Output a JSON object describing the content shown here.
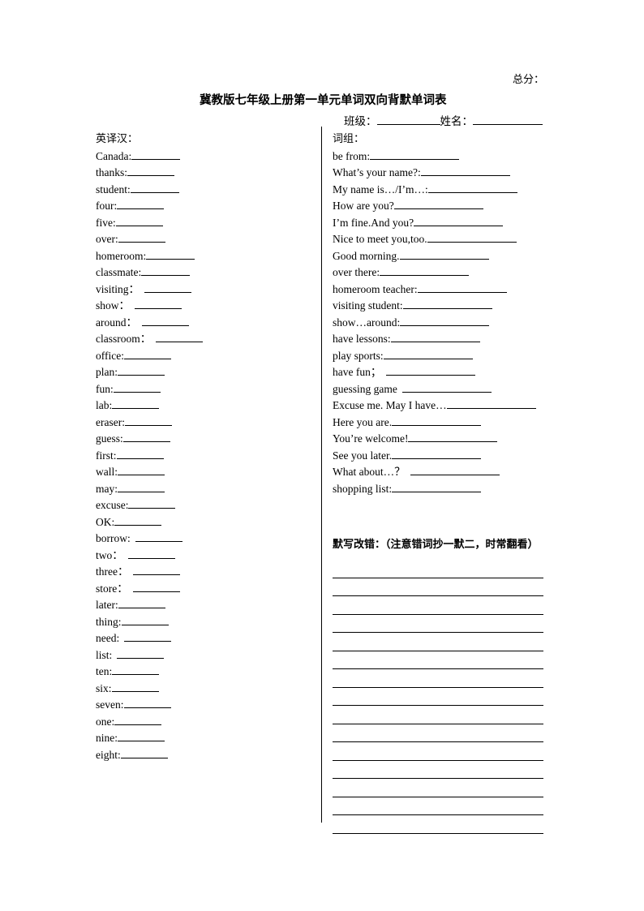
{
  "header": {
    "total_score_label": "总分：",
    "title": "冀教版七年级上册第一单元单词双向背默单词表",
    "class_label": "班级：",
    "name_label": "姓名："
  },
  "left_column": {
    "heading": "英译汉：",
    "entries": [
      {
        "label": "Canada:",
        "blank_width": 60,
        "spaced": false
      },
      {
        "label": "thanks:",
        "blank_width": 58,
        "spaced": false
      },
      {
        "label": "student:",
        "blank_width": 60,
        "spaced": false
      },
      {
        "label": "four:",
        "blank_width": 58,
        "spaced": false
      },
      {
        "label": "five:",
        "blank_width": 58,
        "spaced": false
      },
      {
        "label": "over:",
        "blank_width": 58,
        "spaced": false
      },
      {
        "label": "homeroom:",
        "blank_width": 60,
        "spaced": false
      },
      {
        "label": "classmate:",
        "blank_width": 60,
        "spaced": false
      },
      {
        "label": "visiting：",
        "blank_width": 58,
        "spaced": true
      },
      {
        "label": "show：",
        "blank_width": 58,
        "spaced": true
      },
      {
        "label": "around：",
        "blank_width": 58,
        "spaced": true
      },
      {
        "label": "classroom：",
        "blank_width": 58,
        "spaced": true
      },
      {
        "label": "office:",
        "blank_width": 58,
        "spaced": false
      },
      {
        "label": "plan:",
        "blank_width": 58,
        "spaced": false
      },
      {
        "label": "fun:",
        "blank_width": 58,
        "spaced": false
      },
      {
        "label": "lab:",
        "blank_width": 58,
        "spaced": false
      },
      {
        "label": "eraser:",
        "blank_width": 58,
        "spaced": false
      },
      {
        "label": "guess:",
        "blank_width": 58,
        "spaced": false
      },
      {
        "label": "first:",
        "blank_width": 58,
        "spaced": false
      },
      {
        "label": "wall:",
        "blank_width": 58,
        "spaced": false
      },
      {
        "label": "may:",
        "blank_width": 58,
        "spaced": false
      },
      {
        "label": "excuse:",
        "blank_width": 58,
        "spaced": false
      },
      {
        "label": "OK:",
        "blank_width": 58,
        "spaced": false
      },
      {
        "label": "borrow:",
        "blank_width": 58,
        "spaced": true
      },
      {
        "label": "two：",
        "blank_width": 58,
        "spaced": true
      },
      {
        "label": "three：",
        "blank_width": 58,
        "spaced": true
      },
      {
        "label": "store：",
        "blank_width": 58,
        "spaced": true
      },
      {
        "label": "later:",
        "blank_width": 58,
        "spaced": false
      },
      {
        "label": "thing:",
        "blank_width": 58,
        "spaced": false
      },
      {
        "label": "need:",
        "blank_width": 58,
        "spaced": true
      },
      {
        "label": "list:",
        "blank_width": 58,
        "spaced": true
      },
      {
        "label": "ten:",
        "blank_width": 58,
        "spaced": false
      },
      {
        "label": "six:",
        "blank_width": 58,
        "spaced": false
      },
      {
        "label": "seven:",
        "blank_width": 58,
        "spaced": false
      },
      {
        "label": "one:",
        "blank_width": 58,
        "spaced": false
      },
      {
        "label": "nine:",
        "blank_width": 58,
        "spaced": false
      },
      {
        "label": "eight:",
        "blank_width": 58,
        "spaced": false
      }
    ]
  },
  "right_column": {
    "heading": "词组：",
    "entries": [
      {
        "label": "be from:",
        "blank_width": 110,
        "spaced": false
      },
      {
        "label": "What’s your name?:",
        "blank_width": 110,
        "spaced": false
      },
      {
        "label": "My name is…/I’m…:",
        "blank_width": 110,
        "spaced": false
      },
      {
        "label": "How are you?",
        "blank_width": 110,
        "spaced": false
      },
      {
        "label": "I’m fine.And you?",
        "blank_width": 110,
        "spaced": false
      },
      {
        "label": "Nice to meet you,too.",
        "blank_width": 110,
        "spaced": false
      },
      {
        "label": "Good morning.",
        "blank_width": 110,
        "spaced": false
      },
      {
        "label": "over there:",
        "blank_width": 110,
        "spaced": false
      },
      {
        "label": "homeroom teacher:",
        "blank_width": 110,
        "spaced": false
      },
      {
        "label": "visiting student:",
        "blank_width": 110,
        "spaced": false
      },
      {
        "label": "show…around:",
        "blank_width": 110,
        "spaced": false
      },
      {
        "label": "have lessons:",
        "blank_width": 110,
        "spaced": false
      },
      {
        "label": "play sports:",
        "blank_width": 110,
        "spaced": false
      },
      {
        "label": "have fun；",
        "blank_width": 110,
        "spaced": true
      },
      {
        "label": "guessing game",
        "blank_width": 110,
        "spaced": true
      },
      {
        "label": "Excuse me. May I have…",
        "blank_width": 110,
        "spaced": false
      },
      {
        "label": "Here you are.",
        "blank_width": 110,
        "spaced": false
      },
      {
        "label": "You’re welcome!",
        "blank_width": 110,
        "spaced": false
      },
      {
        "label": "See you later.",
        "blank_width": 110,
        "spaced": false
      },
      {
        "label": "What about…？",
        "blank_width": 110,
        "spaced": true
      },
      {
        "label": "shopping list:",
        "blank_width": 110,
        "spaced": false
      }
    ]
  },
  "correction": {
    "heading": "默写改错：（注意错词抄一默二，时常翻看）",
    "line_count": 15
  },
  "colors": {
    "ink": "#000000",
    "paper": "#ffffff"
  }
}
